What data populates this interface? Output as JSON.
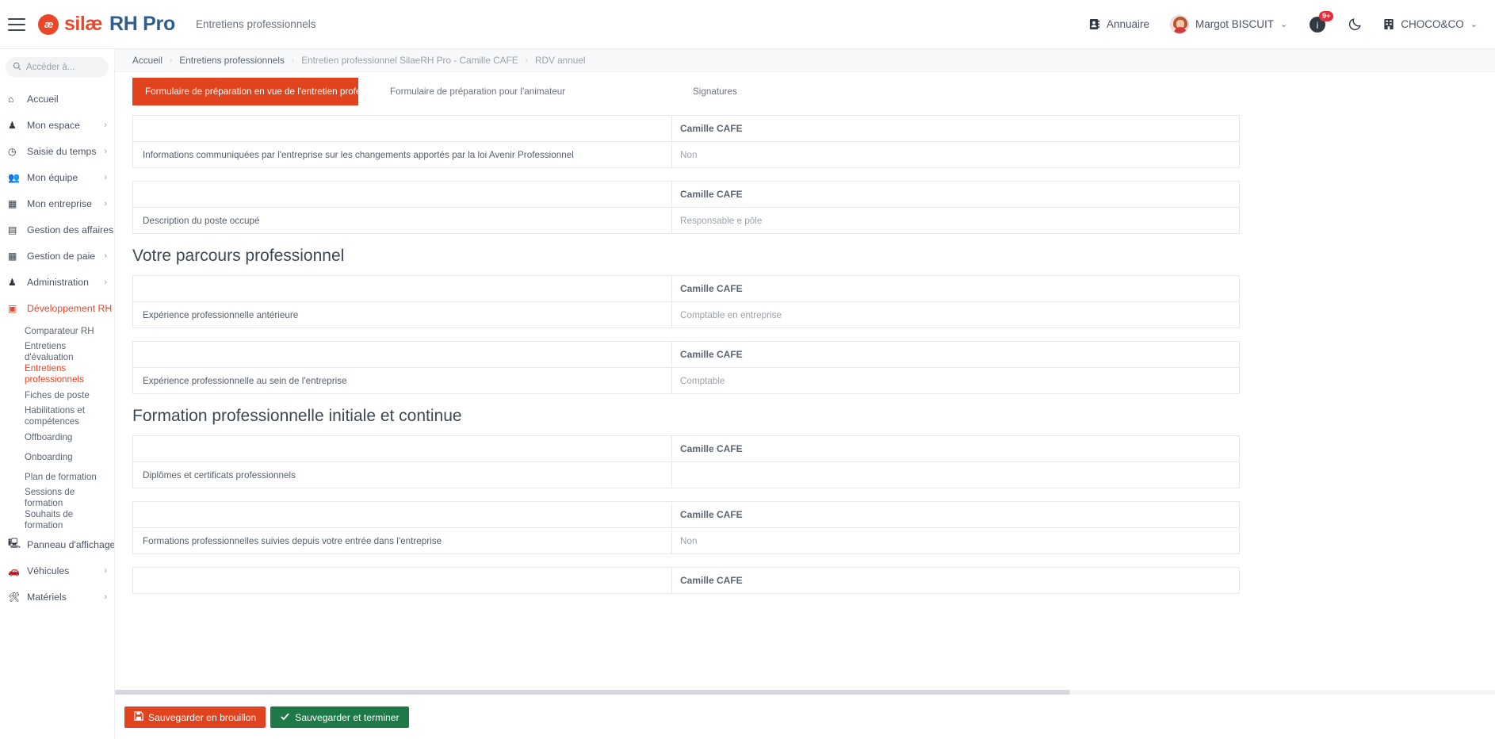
{
  "topbar": {
    "menu_icon": "hamburger-icon",
    "brand_mark": "æ",
    "brand_silae": "silæ",
    "brand_rhpro": "RH Pro",
    "context_title": "Entretiens professionnels",
    "directory_label": "Annuaire",
    "directory_icon": "address-book-icon",
    "user_name": "Margot BISCUIT",
    "user_caret": "⌄",
    "notification_icon": "notification-bell-icon",
    "notification_badge": "9+",
    "theme_icon": "moon-icon",
    "company_icon": "building-icon",
    "company_name": "CHOCO&CO",
    "company_caret": "⌄"
  },
  "sidebar": {
    "search_placeholder": "Accéder à...",
    "search_icon": "search-icon",
    "items": [
      {
        "label": "Accueil",
        "icon": "home-icon",
        "glyph": "⌂",
        "chevron": "",
        "active": false
      },
      {
        "label": "Mon espace",
        "icon": "user-icon",
        "glyph": "♟",
        "chevron": "›",
        "active": false
      },
      {
        "label": "Saisie du temps",
        "icon": "clock-icon",
        "glyph": "◷",
        "chevron": "›",
        "active": false
      },
      {
        "label": "Mon équipe",
        "icon": "users-icon",
        "glyph": "👥",
        "chevron": "›",
        "active": false
      },
      {
        "label": "Mon entreprise",
        "icon": "grid-icon",
        "glyph": "▦",
        "chevron": "›",
        "active": false
      },
      {
        "label": "Gestion des affaires",
        "icon": "clipboard-check-icon",
        "glyph": "▤",
        "chevron": "›",
        "active": false
      },
      {
        "label": "Gestion de paie",
        "icon": "table-icon",
        "glyph": "▦",
        "chevron": "›",
        "active": false
      },
      {
        "label": "Administration",
        "icon": "tie-icon",
        "glyph": "♟",
        "chevron": "›",
        "active": false
      },
      {
        "label": "Développement RH",
        "icon": "id-card-icon",
        "glyph": "▣",
        "chevron": "⌄",
        "active": true
      }
    ],
    "sub_items": [
      {
        "label": "Comparateur RH",
        "active": false
      },
      {
        "label": "Entretiens d'évaluation",
        "active": false
      },
      {
        "label": "Entretiens professionnels",
        "active": true
      },
      {
        "label": "Fiches de poste",
        "active": false
      },
      {
        "label": "Habilitations et compétences",
        "active": false
      },
      {
        "label": "Offboarding",
        "active": false
      },
      {
        "label": "Onboarding",
        "active": false
      },
      {
        "label": "Plan de formation",
        "active": false
      },
      {
        "label": "Sessions de formation",
        "active": false
      },
      {
        "label": "Souhaits de formation",
        "active": false
      }
    ],
    "bottom_items": [
      {
        "label": "Panneau d'affichage",
        "icon": "presentation-icon",
        "glyph": "🖳",
        "chevron": "›"
      },
      {
        "label": "Véhicules",
        "icon": "car-icon",
        "glyph": "🚗",
        "chevron": "›"
      },
      {
        "label": "Matériels",
        "icon": "tools-icon",
        "glyph": "🛠",
        "chevron": "›"
      }
    ],
    "collapse_arrow": "›"
  },
  "breadcrumb": [
    {
      "label": "Accueil",
      "muted": false
    },
    {
      "label": "Entretiens professionnels",
      "muted": false
    },
    {
      "label": "Entretien professionnel SilaeRH Pro - Camille CAFE",
      "muted": true
    },
    {
      "label": "RDV annuel",
      "muted": true
    }
  ],
  "breadcrumb_separator": "›",
  "tabs": [
    {
      "label": "Formulaire de préparation en vue de l'entretien profession...",
      "active": true
    },
    {
      "label": "Formulaire de préparation pour l'animateur",
      "active": false
    },
    {
      "label": "Signatures",
      "active": false
    }
  ],
  "content": {
    "respondent": "Camille CAFE",
    "blocks": [
      {
        "section_title": null,
        "rows": [
          {
            "question": "Informations communiquées par l'entreprise sur les changements apportés par la loi Avenir Professionnel",
            "answer": "Non"
          }
        ]
      },
      {
        "section_title": null,
        "rows": [
          {
            "question": "Description du poste occupé",
            "answer": "Responsable e pôle"
          }
        ]
      },
      {
        "section_title": "Votre parcours professionnel",
        "rows": [
          {
            "question": "Expérience professionnelle antérieure",
            "answer": "Comptable en entreprise"
          }
        ]
      },
      {
        "section_title": null,
        "rows": [
          {
            "question": "Expérience professionnelle au sein de l'entreprise",
            "answer": "Comptable"
          }
        ]
      },
      {
        "section_title": "Formation professionnelle initiale et continue",
        "rows": [
          {
            "question": "Diplômes et certificats professionnels",
            "answer": ""
          }
        ]
      },
      {
        "section_title": null,
        "rows": [
          {
            "question": "Formations professionnelles suivies depuis votre entrée dans l'entreprise",
            "answer": "Non"
          }
        ]
      },
      {
        "section_title": null,
        "rows": []
      }
    ]
  },
  "footer": {
    "draft_label": "Sauvegarder en brouillon",
    "draft_icon": "save-icon",
    "finish_label": "Sauvegarder et terminer",
    "finish_icon": "check-icon"
  }
}
